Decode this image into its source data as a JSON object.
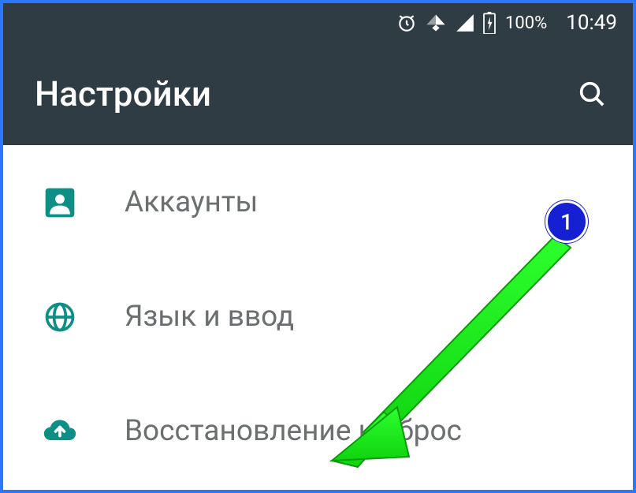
{
  "status": {
    "battery_percent": "100%",
    "time": "10:49"
  },
  "appbar": {
    "title": "Настройки"
  },
  "items": [
    {
      "label": "Аккаунты",
      "icon": "account"
    },
    {
      "label": "Язык и ввод",
      "icon": "globe"
    },
    {
      "label": "Восстановление и сброс",
      "icon": "backup"
    }
  ],
  "annotation": {
    "badge": "1"
  },
  "colors": {
    "teal": "#0e8f86",
    "statusbg": "#303c44",
    "arrow": "#2dff2d",
    "badge": "#1520d3"
  }
}
